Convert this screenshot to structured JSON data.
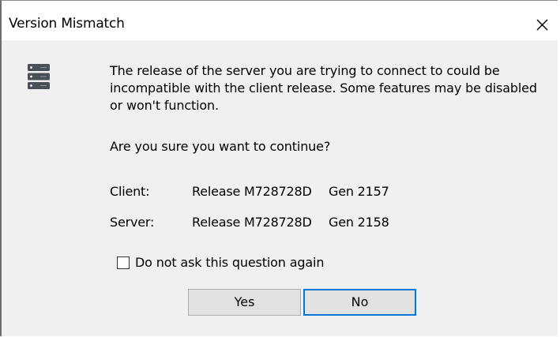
{
  "window": {
    "title": "Version Mismatch",
    "close_icon": "close-icon"
  },
  "icon": {
    "name": "server-icon"
  },
  "message": "The release of the server you are trying to connect to could be incompatible with the client release. Some features may be disabled or won't function.",
  "question": "Are you sure you want to continue?",
  "versions": {
    "client": {
      "label": "Client:",
      "release": "Release M728728D",
      "gen": "Gen 2157"
    },
    "server": {
      "label": "Server:",
      "release": "Release M728728D",
      "gen": "Gen 2158"
    }
  },
  "checkbox": {
    "label": "Do not ask this question again",
    "checked": false
  },
  "buttons": {
    "yes": "Yes",
    "no": "No"
  },
  "colors": {
    "focus_border": "#0078d7",
    "dialog_bg": "#f0f0f0",
    "button_bg": "#e1e1e1"
  }
}
